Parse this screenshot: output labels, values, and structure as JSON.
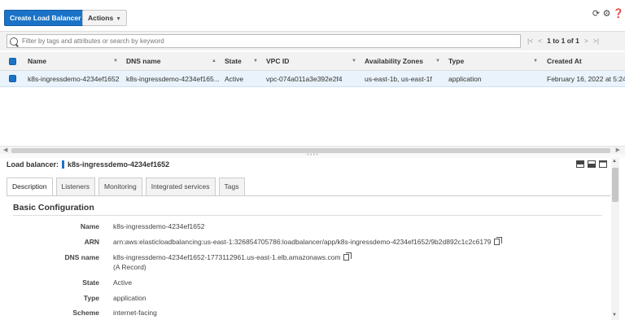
{
  "toolbar": {
    "create_label": "Create Load Balancer",
    "actions_label": "Actions",
    "icons": [
      "refresh-icon",
      "settings-icon",
      "help-icon"
    ]
  },
  "search": {
    "placeholder": "Filter by tags and attributes or search by keyword",
    "pager_text": "1 to 1 of 1"
  },
  "table": {
    "columns": [
      "Name",
      "DNS name",
      "State",
      "VPC ID",
      "Availability Zones",
      "Type",
      "Created At"
    ],
    "rows": [
      {
        "name": "k8s-ingressdemo-4234ef1652",
        "dns": "k8s-ingressdemo-4234ef165...",
        "state": "Active",
        "vpc": "vpc-074a011a3e392e2f4",
        "zones": "us-east-1b, us-east-1f",
        "type": "application",
        "created": "February 16, 2022 at 5:24"
      }
    ]
  },
  "detail": {
    "label": "Load balancer:",
    "name": "k8s-ingressdemo-4234ef1652",
    "tabs": [
      "Description",
      "Listeners",
      "Monitoring",
      "Integrated services",
      "Tags"
    ],
    "section_title": "Basic Configuration",
    "fields": [
      {
        "key": "Name",
        "value": "k8s-ingressdemo-4234ef1652"
      },
      {
        "key": "ARN",
        "value": "arn:aws:elasticloadbalancing:us-east-1:326854705786:loadbalancer/app/k8s-ingressdemo-4234ef1652/9b2d892c1c2c6179"
      },
      {
        "key": "DNS name",
        "value": "k8s-ingressdemo-4234ef1652-1773112961.us-east-1.elb.amazonaws.com",
        "extra": "(A Record)"
      },
      {
        "key": "State",
        "value": "Active"
      },
      {
        "key": "Type",
        "value": "application"
      },
      {
        "key": "Scheme",
        "value": "internet-facing"
      }
    ]
  },
  "colors": {
    "accent": "#1b73c7",
    "row_selected": "#eaf3fb",
    "header_bg": "#f2f2f2"
  }
}
